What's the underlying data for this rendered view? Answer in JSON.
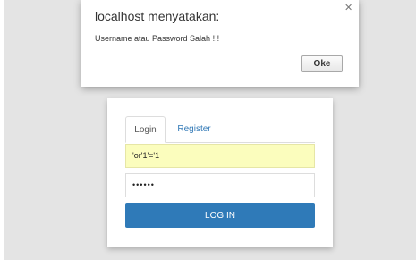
{
  "dialog": {
    "title": "localhost menyatakan:",
    "message": "Username atau Password Salah !!!",
    "ok_label": "Oke",
    "close_icon": "close-icon"
  },
  "login_card": {
    "tabs": [
      {
        "label": "Login",
        "active": true
      },
      {
        "label": "Register",
        "active": false
      }
    ],
    "username_value": "'or'1'='1",
    "password_masked": "••••••",
    "login_button_label": "LOG IN",
    "colors": {
      "button": "#2f7ab8",
      "tab_link": "#337ab7",
      "autofill": "#fbfdbd"
    }
  }
}
